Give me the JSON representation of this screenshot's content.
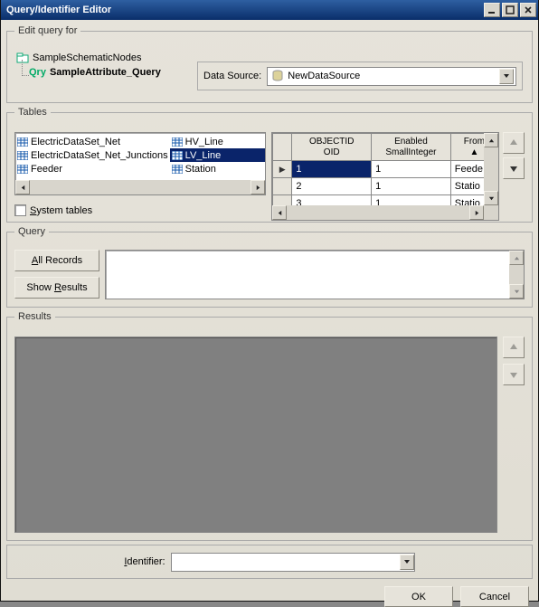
{
  "window": {
    "title": "Query/Identifier Editor"
  },
  "editQuery": {
    "legend": "Edit query for",
    "rootNode": "SampleSchematicNodes",
    "childPrefix": "Qry",
    "childName": "SampleAttribute_Query",
    "dataSourceLabel": "Data Source:",
    "dataSourceValue": "NewDataSource"
  },
  "tables": {
    "legend": "Tables",
    "systemTablesLabel": "System tables",
    "col1": [
      "ElectricDataSet_Net",
      "ElectricDataSet_Net_Junctions",
      "Feeder"
    ],
    "col2": [
      "HV_Line",
      "LV_Line",
      "Station"
    ],
    "selected": "LV_Line",
    "grid": {
      "headers": [
        {
          "line1": "OBJECTID",
          "line2": "OID"
        },
        {
          "line1": "Enabled",
          "line2": "SmallInteger"
        },
        {
          "line1": "From",
          "line2": ""
        }
      ],
      "rows": [
        {
          "c1": "1",
          "c2": "1",
          "c3": "Feede",
          "selected": true
        },
        {
          "c1": "2",
          "c2": "1",
          "c3": "Statio",
          "selected": false
        },
        {
          "c1": "3",
          "c2": "1",
          "c3": "Statio",
          "selected": false
        }
      ]
    }
  },
  "query": {
    "legend": "Query",
    "allRecords": "All Records",
    "showResults": "Show Results",
    "text": ""
  },
  "results": {
    "legend": "Results"
  },
  "identifier": {
    "label": "Identifier:",
    "value": ""
  },
  "buttons": {
    "ok": "OK",
    "cancel": "Cancel"
  }
}
